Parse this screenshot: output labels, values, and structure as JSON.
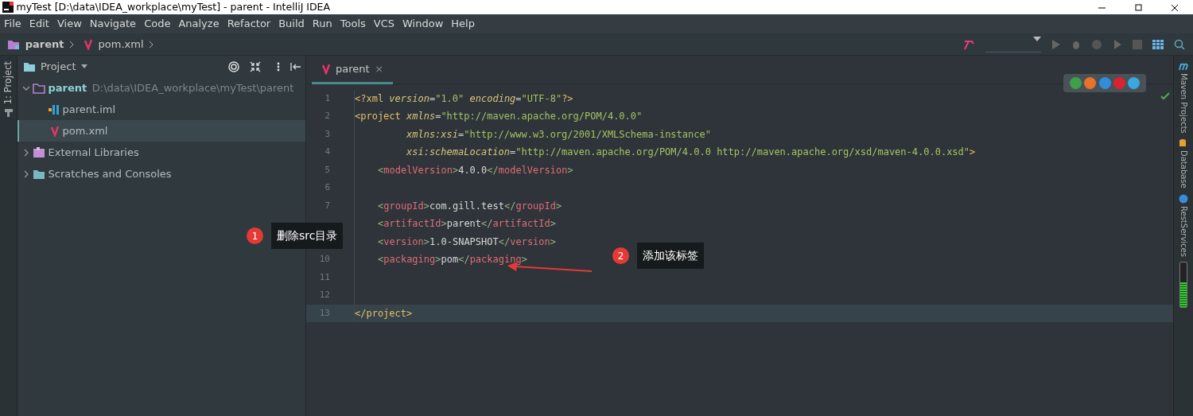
{
  "window": {
    "title": "myTest [D:\\data\\IDEA_workplace\\myTest] - parent - IntelliJ IDEA"
  },
  "menu": [
    {
      "label": "File"
    },
    {
      "label": "Edit"
    },
    {
      "label": "View"
    },
    {
      "label": "Navigate"
    },
    {
      "label": "Code"
    },
    {
      "label": "Analyze"
    },
    {
      "label": "Refactor"
    },
    {
      "label": "Build"
    },
    {
      "label": "Run"
    },
    {
      "label": "Tools"
    },
    {
      "label": "VCS"
    },
    {
      "label": "Window"
    },
    {
      "label": "Help"
    }
  ],
  "breadcrumb": [
    {
      "label": "parent",
      "kind": "module"
    },
    {
      "label": "pom.xml",
      "kind": "maven"
    }
  ],
  "left_strip": [
    {
      "label": "1: Project"
    }
  ],
  "project_panel": {
    "title": "Project",
    "tree": [
      {
        "label": "parent",
        "path": "D:\\data\\IDEA_workplace\\myTest\\parent",
        "kind": "module",
        "expanded": true,
        "selected": false,
        "children": [
          {
            "label": "parent.iml",
            "kind": "iml",
            "selected": false
          },
          {
            "label": "pom.xml",
            "kind": "maven",
            "selected": true
          }
        ]
      },
      {
        "label": "External Libraries",
        "kind": "library",
        "expanded": false,
        "selected": false
      },
      {
        "label": "Scratches and Consoles",
        "kind": "scratch",
        "expanded": false,
        "selected": false
      }
    ]
  },
  "editor": {
    "tabs": [
      {
        "label": "parent",
        "close": "×",
        "selected": true
      }
    ],
    "lines": [
      {
        "number": "1",
        "kind": "root",
        "highlighted": false,
        "tokens": [
          {
            "kind": "pi",
            "text": "<?xml "
          },
          {
            "kind": "attr",
            "text": "version"
          },
          {
            "kind": "text",
            "text": "="
          },
          {
            "kind": "val",
            "text": "\"1.0\" "
          },
          {
            "kind": "attr",
            "text": "encoding"
          },
          {
            "kind": "text",
            "text": "="
          },
          {
            "kind": "val",
            "text": "\"UTF-8\""
          },
          {
            "kind": "pi",
            "text": "?>"
          }
        ]
      },
      {
        "number": "2",
        "kind": "root",
        "highlighted": false,
        "tokens": [
          {
            "kind": "root",
            "text": "<project "
          },
          {
            "kind": "attr",
            "text": "xmlns"
          },
          {
            "kind": "text",
            "text": "="
          },
          {
            "kind": "val",
            "text": "\"http://maven.apache.org/POM/4.0.0\""
          }
        ]
      },
      {
        "number": "3",
        "kind": "attribute",
        "highlighted": false,
        "tokens": [
          {
            "kind": "attr",
            "text": "xmlns:xsi"
          },
          {
            "kind": "text",
            "text": "="
          },
          {
            "kind": "val",
            "text": "\"http://www.w3.org/2001/XMLSchema-instance\""
          }
        ]
      },
      {
        "number": "4",
        "kind": "attribute",
        "highlighted": false,
        "tokens": [
          {
            "kind": "attr",
            "text": "xsi:schemaLocation"
          },
          {
            "kind": "text",
            "text": "="
          },
          {
            "kind": "val",
            "text": "\"http://maven.apache.org/POM/4.0.0 http://maven.apache.org/xsd/maven-4.0.0.xsd\""
          },
          {
            "kind": "root",
            "text": ">"
          }
        ]
      },
      {
        "number": "5",
        "kind": "child",
        "highlighted": false,
        "tokens": [
          {
            "kind": "punct",
            "text": "<"
          },
          {
            "kind": "tag",
            "text": "modelVersion"
          },
          {
            "kind": "punct",
            "text": ">"
          },
          {
            "kind": "text",
            "text": "4.0.0"
          },
          {
            "kind": "punct",
            "text": "</"
          },
          {
            "kind": "tag",
            "text": "modelVersion"
          },
          {
            "kind": "punct",
            "text": ">"
          }
        ]
      },
      {
        "number": "6",
        "kind": "blank",
        "highlighted": false
      },
      {
        "number": "7",
        "kind": "child",
        "highlighted": false,
        "tokens": [
          {
            "kind": "punct",
            "text": "<"
          },
          {
            "kind": "tag",
            "text": "groupId"
          },
          {
            "kind": "punct",
            "text": ">"
          },
          {
            "kind": "text",
            "text": "com.gill.test"
          },
          {
            "kind": "punct",
            "text": "</"
          },
          {
            "kind": "tag",
            "text": "groupId"
          },
          {
            "kind": "punct",
            "text": ">"
          }
        ]
      },
      {
        "kind": "child",
        "highlighted": false,
        "tokens": [
          {
            "kind": "punct",
            "text": "<"
          },
          {
            "kind": "tag",
            "text": "artifactId"
          },
          {
            "kind": "punct",
            "text": ">"
          },
          {
            "kind": "text",
            "text": "parent"
          },
          {
            "kind": "punct",
            "text": "</"
          },
          {
            "kind": "tag",
            "text": "artifactId"
          },
          {
            "kind": "punct",
            "text": ">"
          }
        ]
      },
      {
        "kind": "child",
        "highlighted": false,
        "tokens": [
          {
            "kind": "punct",
            "text": "<"
          },
          {
            "kind": "tag",
            "text": "version"
          },
          {
            "kind": "punct",
            "text": ">"
          },
          {
            "kind": "text",
            "text": "1.0-SNAPSHOT"
          },
          {
            "kind": "punct",
            "text": "</"
          },
          {
            "kind": "tag",
            "text": "version"
          },
          {
            "kind": "punct",
            "text": ">"
          }
        ]
      },
      {
        "number": "10",
        "kind": "child",
        "highlighted": false,
        "tokens": [
          {
            "kind": "punct",
            "text": "<"
          },
          {
            "kind": "tag",
            "text": "packaging"
          },
          {
            "kind": "punct",
            "text": ">"
          },
          {
            "kind": "text",
            "text": "pom"
          },
          {
            "kind": "punct",
            "text": "</"
          },
          {
            "kind": "tag",
            "text": "packaging"
          },
          {
            "kind": "punct",
            "text": ">"
          }
        ]
      },
      {
        "number": "11",
        "kind": "blank",
        "highlighted": false
      },
      {
        "number": "12",
        "kind": "blank",
        "highlighted": false
      },
      {
        "number": "13",
        "kind": "root",
        "highlighted": true,
        "tokens": [
          {
            "kind": "root",
            "text": "</project>"
          }
        ]
      }
    ]
  },
  "right_strip": [
    {
      "label": "Maven Projects",
      "kind": "maven"
    },
    {
      "label": "Database",
      "kind": "database"
    },
    {
      "label": "RestServices",
      "kind": "rest"
    }
  ],
  "memory": {
    "level": 0.55
  },
  "annotations": [
    {
      "number": "1",
      "label": "删除src目录"
    },
    {
      "number": "2",
      "label": "添加该标签"
    }
  ]
}
